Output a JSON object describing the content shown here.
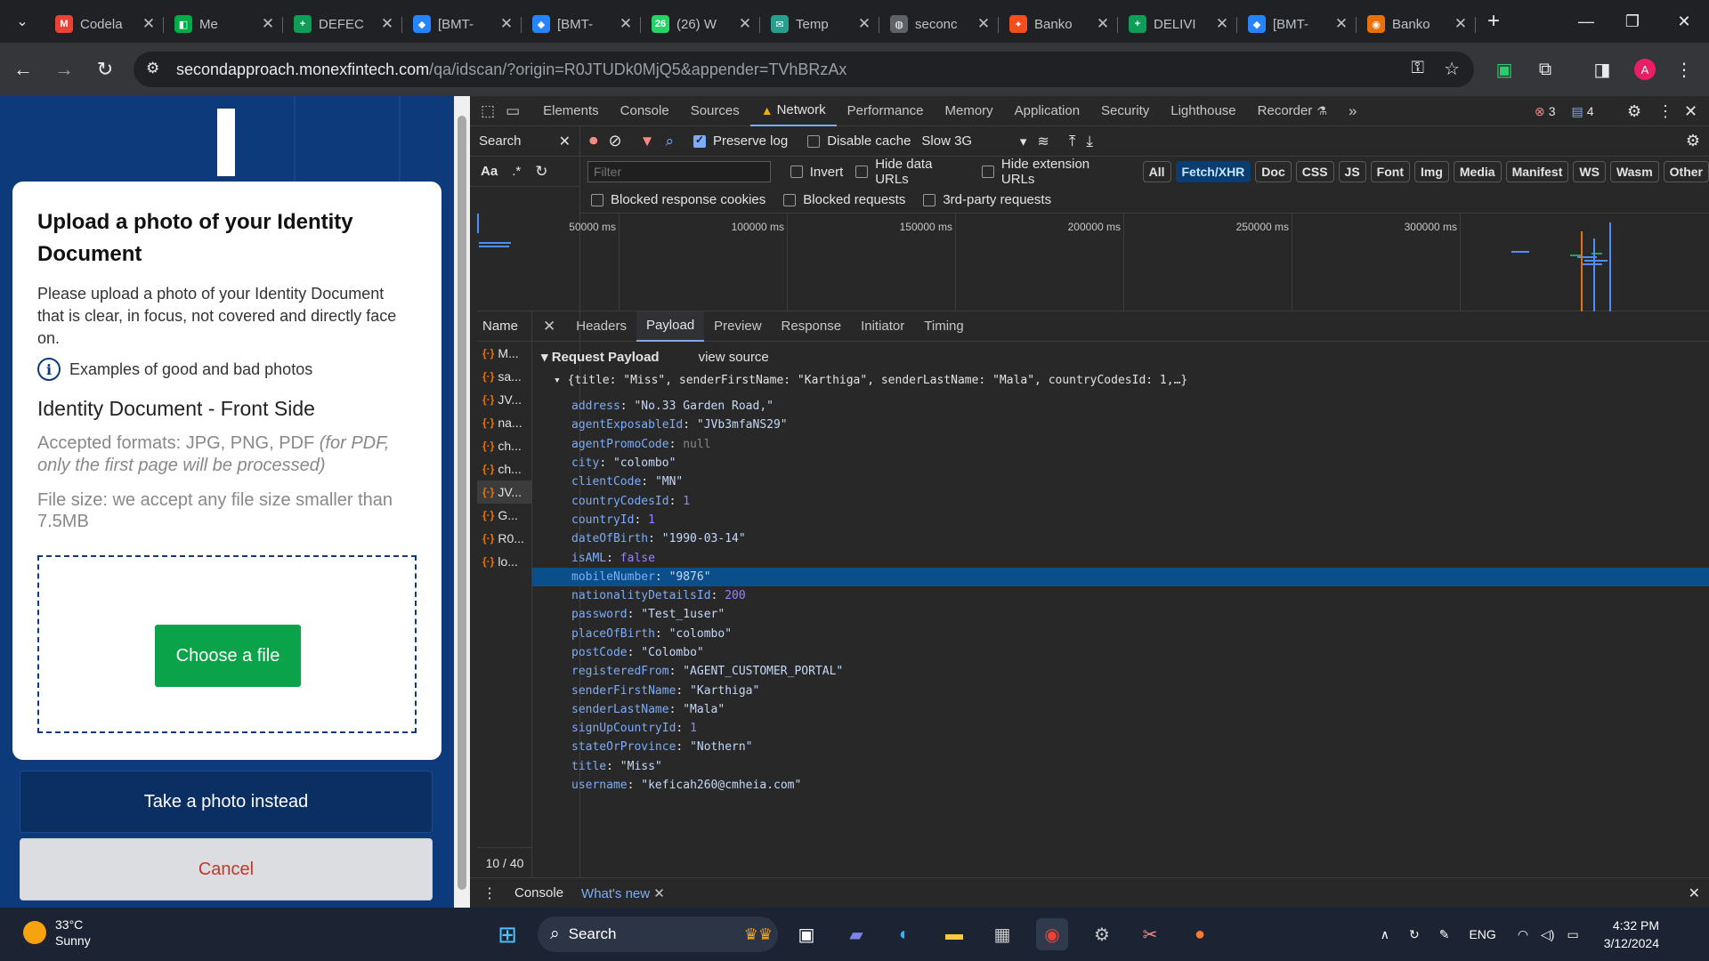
{
  "browser": {
    "tabs": [
      {
        "title": "Codela",
        "icon": "gmail-icon",
        "color": "#ea4335",
        "glyph": "M"
      },
      {
        "title": "Me",
        "icon": "meet-icon",
        "color": "#00ac47",
        "glyph": "◧"
      },
      {
        "title": "DEFEC",
        "icon": "sheets-icon",
        "color": "#0f9d58",
        "glyph": "+"
      },
      {
        "title": "[BMT-",
        "icon": "jira-icon",
        "color": "#2684ff",
        "glyph": "◆"
      },
      {
        "title": "[BMT-",
        "icon": "jira-icon",
        "color": "#2684ff",
        "glyph": "◆"
      },
      {
        "title": "(26) W",
        "icon": "whatsapp-icon",
        "color": "#25d366",
        "glyph": "26"
      },
      {
        "title": "Temp",
        "icon": "temp-mail-icon",
        "color": "#2a9d8f",
        "glyph": "✉"
      },
      {
        "title": "seconc",
        "icon": "globe-icon",
        "color": "#5f6368",
        "glyph": "◍"
      },
      {
        "title": "Banko",
        "icon": "figma-icon",
        "color": "#f24e1e",
        "glyph": "✦"
      },
      {
        "title": "DELIVI",
        "icon": "sheets-icon",
        "color": "#0f9d58",
        "glyph": "+"
      },
      {
        "title": "[BMT-",
        "icon": "jira-icon",
        "color": "#2684ff",
        "glyph": "◆"
      },
      {
        "title": "Banko",
        "icon": "web-icon",
        "color": "#e8710a",
        "glyph": "◉"
      }
    ],
    "url_host": "secondapproach.monexfintech.com",
    "url_path": "/qa/idscan/?origin=R0JTUDk0MjQ5&appender=TVhBRzAx",
    "profile_initial": "A"
  },
  "page": {
    "title": "Upload a photo of your Identity Document",
    "description": "Please upload a photo of your Identity Document that is clear, in focus, not covered and directly face on.",
    "examples_link": "Examples of good and bad photos",
    "section_title": "Identity Document - Front Side",
    "formats_text": "Accepted formats: JPG, PNG, PDF",
    "formats_note": "(for PDF, only the first page will be processed)",
    "size_text": "File size: we accept any file size smaller than 7.5MB",
    "choose_file": "Choose a file",
    "take_photo": "Take a photo instead",
    "cancel": "Cancel"
  },
  "devtools": {
    "tabs": [
      "Elements",
      "Console",
      "Sources",
      "Network",
      "Performance",
      "Memory",
      "Application",
      "Security",
      "Lighthouse",
      "Recorder"
    ],
    "active_tab": "Network",
    "error_count": "3",
    "message_count": "4",
    "search_label": "Search",
    "search_case": "Aa",
    "search_regex": ".*",
    "toolbar": {
      "preserve_log": "Preserve log",
      "disable_cache": "Disable cache",
      "throttle": "Slow 3G"
    },
    "filter_placeholder": "Filter",
    "filters": {
      "invert": "Invert",
      "hide_data": "Hide data URLs",
      "hide_ext": "Hide extension URLs"
    },
    "chips": [
      "All",
      "Fetch/XHR",
      "Doc",
      "CSS",
      "JS",
      "Font",
      "Img",
      "Media",
      "Manifest",
      "WS",
      "Wasm",
      "Other"
    ],
    "active_chip": "Fetch/XHR",
    "row3": {
      "blocked_cookies": "Blocked response cookies",
      "blocked_requests": "Blocked requests",
      "third_party": "3rd-party requests"
    },
    "timeline_ticks": [
      "50000 ms",
      "100000 ms",
      "150000 ms",
      "200000 ms",
      "250000 ms",
      "300000 ms"
    ],
    "name_header": "Name",
    "requests": [
      "M...",
      "sa...",
      "JV...",
      "na...",
      "ch...",
      "ch...",
      "JV...",
      "G...",
      "R0...",
      "lo..."
    ],
    "selected_request": 6,
    "request_count": "10 / 40",
    "detail_tabs": [
      "Headers",
      "Payload",
      "Preview",
      "Response",
      "Initiator",
      "Timing"
    ],
    "active_detail_tab": "Payload",
    "payload_title": "Request Payload",
    "view_source": "view source",
    "payload_summary": "{title: \"Miss\", senderFirstName: \"Karthiga\", senderLastName: \"Mala\", countryCodesId: 1,…}",
    "payload": [
      {
        "key": "address",
        "value": "\"No.33 Garden Road,\"",
        "type": "str"
      },
      {
        "key": "agentExposableId",
        "value": "\"JVb3mfaNS29\"",
        "type": "str"
      },
      {
        "key": "agentPromoCode",
        "value": "null",
        "type": "null"
      },
      {
        "key": "city",
        "value": "\"colombo\"",
        "type": "str"
      },
      {
        "key": "clientCode",
        "value": "\"MN\"",
        "type": "str"
      },
      {
        "key": "countryCodesId",
        "value": "1",
        "type": "num"
      },
      {
        "key": "countryId",
        "value": "1",
        "type": "num"
      },
      {
        "key": "dateOfBirth",
        "value": "\"1990-03-14\"",
        "type": "str"
      },
      {
        "key": "isAML",
        "value": "false",
        "type": "num"
      },
      {
        "key": "mobileNumber",
        "value": "\"9876\"",
        "type": "str"
      },
      {
        "key": "nationalityDetailsId",
        "value": "200",
        "type": "num"
      },
      {
        "key": "password",
        "value": "\"Test_1user\"",
        "type": "str"
      },
      {
        "key": "placeOfBirth",
        "value": "\"colombo\"",
        "type": "str"
      },
      {
        "key": "postCode",
        "value": "\"Colombo\"",
        "type": "str"
      },
      {
        "key": "registeredFrom",
        "value": "\"AGENT_CUSTOMER_PORTAL\"",
        "type": "str"
      },
      {
        "key": "senderFirstName",
        "value": "\"Karthiga\"",
        "type": "str"
      },
      {
        "key": "senderLastName",
        "value": "\"Mala\"",
        "type": "str"
      },
      {
        "key": "signUpCountryId",
        "value": "1",
        "type": "num"
      },
      {
        "key": "stateOrProvince",
        "value": "\"Nothern\"",
        "type": "str"
      },
      {
        "key": "title",
        "value": "\"Miss\"",
        "type": "str"
      },
      {
        "key": "username",
        "value": "\"keficah260@cmheia.com\"",
        "type": "str"
      }
    ],
    "selected_payload": 9,
    "drawer_tabs": [
      "Console",
      "What's new"
    ]
  },
  "taskbar": {
    "temperature": "33°C",
    "weather": "Sunny",
    "search": "Search",
    "language": "ENG",
    "time": "4:32 PM",
    "date": "3/12/2024"
  }
}
